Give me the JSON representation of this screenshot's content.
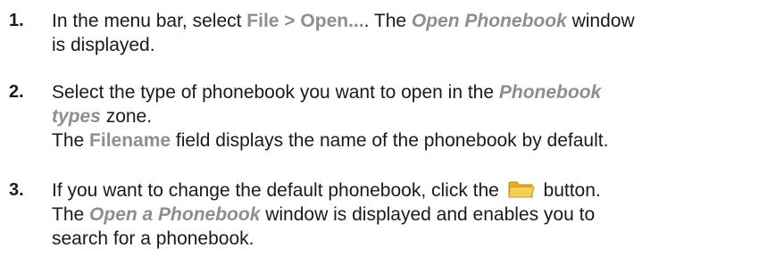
{
  "steps": [
    {
      "number": "1.",
      "parts": {
        "a": "In the menu bar, select ",
        "b": "File > Open...",
        "c": ". The ",
        "d": "Open Phonebook",
        "e": " window",
        "f": "is displayed."
      }
    },
    {
      "number": "2.",
      "parts": {
        "a": "Select the type of phonebook you want to open in the ",
        "b": "Phonebook",
        "c": "types",
        "d": " zone.",
        "e": "The ",
        "f": "Filename",
        "g": " field displays the name of the phonebook by default."
      }
    },
    {
      "number": "3.",
      "parts": {
        "a": "If you want to change the default phonebook, click the ",
        "icon": "folder-icon",
        "b": " button.",
        "c": "The ",
        "d": "Open a Phonebook",
        "e": " window is displayed and enables you to",
        "f": "search for a phonebook."
      }
    }
  ],
  "colors": {
    "ui_term": "#8e8e8e",
    "text": "#1a1a1a",
    "folder_fill": "#f0c23a",
    "folder_dark": "#c99a1a"
  }
}
